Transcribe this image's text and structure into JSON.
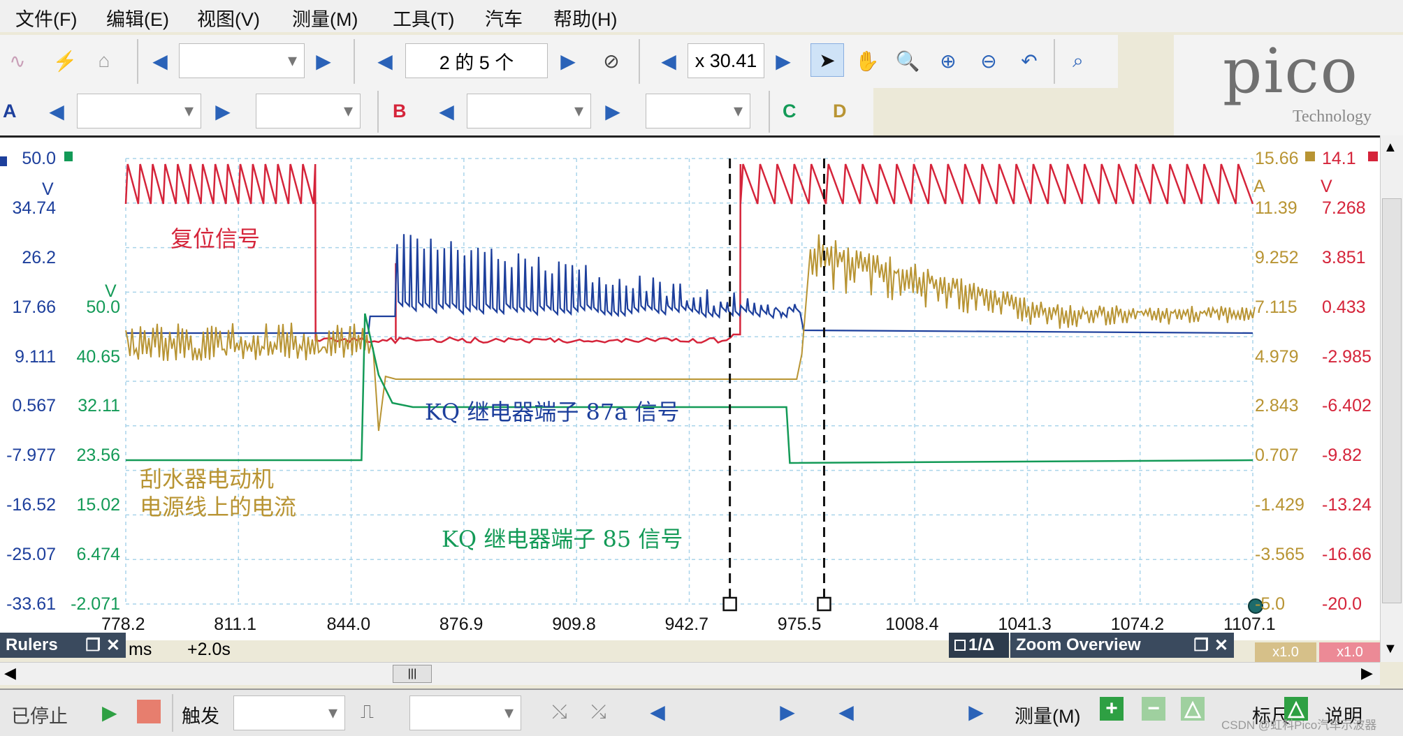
{
  "menu": [
    "文件(F)",
    "编辑(E)",
    "视图(V)",
    "测量(M)",
    "工具(T)",
    "汽车",
    "帮助(H)"
  ],
  "toolbar": {
    "buffer_label": "2 的 5 个",
    "zoom_label": "x 30.41"
  },
  "channels": {
    "a": "A",
    "b": "B",
    "c": "C",
    "d": "D"
  },
  "logo": {
    "brand": "pico",
    "sub": "Technology"
  },
  "axes": {
    "a_unit": "V",
    "a_ticks": [
      "50.0",
      "34.74",
      "26.2",
      "17.66",
      "9.111",
      "0.567",
      "-7.977",
      "-16.52",
      "-25.07",
      "-33.61"
    ],
    "c_unit": "V",
    "c_ticks": [
      "50.0",
      "40.65",
      "32.11",
      "23.56",
      "15.02",
      "6.474",
      "-2.071"
    ],
    "b_unit": "A",
    "b_ticks": [
      "15.66",
      "11.39",
      "9.252",
      "7.115",
      "4.979",
      "2.843",
      "0.707",
      "-1.429",
      "-3.565",
      "-5.0"
    ],
    "d_unit": "V",
    "d_ticks": [
      "14.1",
      "7.268",
      "3.851",
      "0.433",
      "-2.985",
      "-6.402",
      "-9.82",
      "-13.24",
      "-16.66",
      "-20.0"
    ],
    "x_ticks": [
      "778.2",
      "811.1",
      "844.0",
      "876.9",
      "909.8",
      "942.7",
      "975.5",
      "1008.4",
      "1041.3",
      "1074.2",
      "1107.1"
    ],
    "x_unit": "ms",
    "x_offset": "+2.0s"
  },
  "annotations": {
    "reset": "复位信号",
    "kq87a": "KQ 继电器端子 87a 信号",
    "motor_line1": "刮水器电动机",
    "motor_line2": "电源线上的电流",
    "kq85": "KQ 继电器端子 85 信号"
  },
  "panels": {
    "rulers": "Rulers",
    "delta": "1/Δ",
    "zoom_overview": "Zoom Overview",
    "scale_b": "x1.0",
    "scale_d": "x1.0"
  },
  "status": {
    "stopped": "已停止",
    "trigger": "触发",
    "measure": "测量(M)",
    "ruler": "标尺",
    "notes": "说明"
  },
  "watermark": "CSDN @虹科Pico汽车示波器",
  "colors": {
    "red": "#d5243a",
    "blue": "#1d3f9c",
    "green": "#139a57",
    "gold": "#b89433",
    "grid": "#a9d4ea"
  }
}
